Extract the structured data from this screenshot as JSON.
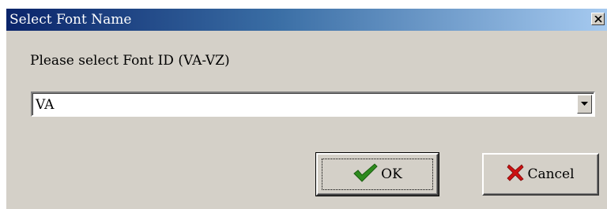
{
  "window": {
    "title": "Select Font Name"
  },
  "dialog": {
    "prompt": "Please select Font ID (VA-VZ)",
    "font_select": {
      "selected_value": "VA"
    }
  },
  "buttons": {
    "ok_label": "OK",
    "cancel_label": "Cancel"
  },
  "colors": {
    "titlebar_start": "#0a246a",
    "titlebar_end": "#a6caf0",
    "dialog_face": "#d4d0c8",
    "ok_check": "#2e8b1e",
    "cancel_x": "#cc1111"
  },
  "icons": {
    "close": "close-icon",
    "dropdown": "chevron-down-icon",
    "ok": "checkmark-icon",
    "cancel": "x-mark-icon"
  }
}
